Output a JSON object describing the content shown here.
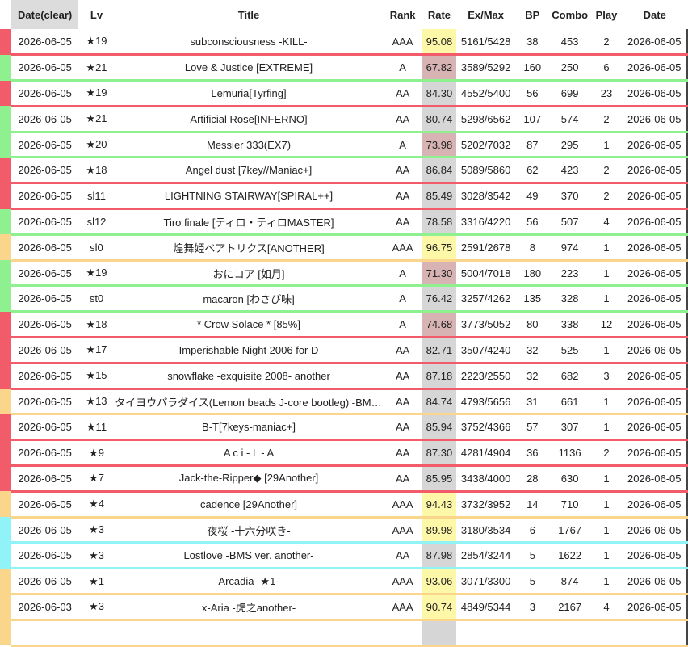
{
  "lamp_colors": {
    "failed": "#f25b6a",
    "easy": "#8ff08f",
    "normal": "#fad68d",
    "hard": "#f25b6a",
    "cyan": "#8ff3f7"
  },
  "rate_colors": {
    "high": "#fdf7a8",
    "mid": "#d6d6d6",
    "low": "#d8b3b3"
  },
  "header": {
    "date_clear": "Date(clear)",
    "lv": "Lv",
    "title": "Title",
    "rank": "Rank",
    "rate": "Rate",
    "exmax": "Ex/Max",
    "bp": "BP",
    "combo": "Combo",
    "play": "Play",
    "date": "Date"
  },
  "rows": [
    {
      "lamp": "#f25b6a",
      "date_clear": "2026-06-05",
      "lv": "★19",
      "title": "subconsciousness -KILL-",
      "rank": "AAA",
      "rate": "95.08",
      "rate_bg": "#fdf7a8",
      "exmax": "5161/5428",
      "bp": "38",
      "combo": "453",
      "play": "2",
      "date": "2026-06-05"
    },
    {
      "lamp": "#8ff08f",
      "date_clear": "2026-06-05",
      "lv": "★21",
      "title": "Love & Justice [EXTREME]",
      "rank": "A",
      "rate": "67.82",
      "rate_bg": "#d8b3b3",
      "exmax": "3589/5292",
      "bp": "160",
      "combo": "250",
      "play": "6",
      "date": "2026-06-05"
    },
    {
      "lamp": "#f25b6a",
      "date_clear": "2026-06-05",
      "lv": "★19",
      "title": "Lemuria[Tyrfing]",
      "rank": "AA",
      "rate": "84.30",
      "rate_bg": "#d6d6d6",
      "exmax": "4552/5400",
      "bp": "56",
      "combo": "699",
      "play": "23",
      "date": "2026-06-05"
    },
    {
      "lamp": "#8ff08f",
      "date_clear": "2026-06-05",
      "lv": "★21",
      "title": "Artificial Rose[INFERNO]",
      "rank": "AA",
      "rate": "80.74",
      "rate_bg": "#d6d6d6",
      "exmax": "5298/6562",
      "bp": "107",
      "combo": "574",
      "play": "2",
      "date": "2026-06-05"
    },
    {
      "lamp": "#8ff08f",
      "date_clear": "2026-06-05",
      "lv": "★20",
      "title": "Messier 333(EX7)",
      "rank": "A",
      "rate": "73.98",
      "rate_bg": "#d8b3b3",
      "exmax": "5202/7032",
      "bp": "87",
      "combo": "295",
      "play": "1",
      "date": "2026-06-05"
    },
    {
      "lamp": "#f25b6a",
      "date_clear": "2026-06-05",
      "lv": "★18",
      "title": "Angel dust [7key//Maniac+]",
      "rank": "AA",
      "rate": "86.84",
      "rate_bg": "#d6d6d6",
      "exmax": "5089/5860",
      "bp": "62",
      "combo": "423",
      "play": "2",
      "date": "2026-06-05"
    },
    {
      "lamp": "#f25b6a",
      "date_clear": "2026-06-05",
      "lv": "sl11",
      "title": "LIGHTNING STAIRWAY[SPIRAL++]",
      "rank": "AA",
      "rate": "85.49",
      "rate_bg": "#d6d6d6",
      "exmax": "3028/3542",
      "bp": "49",
      "combo": "370",
      "play": "2",
      "date": "2026-06-05"
    },
    {
      "lamp": "#8ff08f",
      "date_clear": "2026-06-05",
      "lv": "sl12",
      "title": "Tiro finale [ティロ・ティロMASTER]",
      "rank": "AA",
      "rate": "78.58",
      "rate_bg": "#d6d6d6",
      "exmax": "3316/4220",
      "bp": "56",
      "combo": "507",
      "play": "4",
      "date": "2026-06-05"
    },
    {
      "lamp": "#fad68d",
      "date_clear": "2026-06-05",
      "lv": "sl0",
      "title": "煌舞姫ベアトリクス[ANOTHER]",
      "rank": "AAA",
      "rate": "96.75",
      "rate_bg": "#fdf7a8",
      "exmax": "2591/2678",
      "bp": "8",
      "combo": "974",
      "play": "1",
      "date": "2026-06-05"
    },
    {
      "lamp": "#8ff08f",
      "date_clear": "2026-06-05",
      "lv": "★19",
      "title": "おにコア [如月]",
      "rank": "A",
      "rate": "71.30",
      "rate_bg": "#d8b3b3",
      "exmax": "5004/7018",
      "bp": "180",
      "combo": "223",
      "play": "1",
      "date": "2026-06-05"
    },
    {
      "lamp": "#8ff08f",
      "date_clear": "2026-06-05",
      "lv": "st0",
      "title": "macaron [わさび味]",
      "rank": "A",
      "rate": "76.42",
      "rate_bg": "#d6d6d6",
      "exmax": "3257/4262",
      "bp": "135",
      "combo": "328",
      "play": "1",
      "date": "2026-06-05"
    },
    {
      "lamp": "#f25b6a",
      "date_clear": "2026-06-05",
      "lv": "★18",
      "title": "* Crow Solace * [85%]",
      "rank": "A",
      "rate": "74.68",
      "rate_bg": "#d8b3b3",
      "exmax": "3773/5052",
      "bp": "80",
      "combo": "338",
      "play": "12",
      "date": "2026-06-05"
    },
    {
      "lamp": "#f25b6a",
      "date_clear": "2026-06-05",
      "lv": "★17",
      "title": "Imperishable Night 2006 for D",
      "rank": "AA",
      "rate": "82.71",
      "rate_bg": "#d6d6d6",
      "exmax": "3507/4240",
      "bp": "32",
      "combo": "525",
      "play": "1",
      "date": "2026-06-05"
    },
    {
      "lamp": "#f25b6a",
      "date_clear": "2026-06-05",
      "lv": "★15",
      "title": "snowflake -exquisite 2008- another",
      "rank": "AA",
      "rate": "87.18",
      "rate_bg": "#d6d6d6",
      "exmax": "2223/2550",
      "bp": "32",
      "combo": "682",
      "play": "3",
      "date": "2026-06-05"
    },
    {
      "lamp": "#fad68d",
      "date_clear": "2026-06-05",
      "lv": "★13",
      "title": "タイヨウパラダイス(Lemon beads J-core bootleg) -BMS E...",
      "rank": "AA",
      "rate": "84.74",
      "rate_bg": "#d6d6d6",
      "exmax": "4793/5656",
      "bp": "31",
      "combo": "661",
      "play": "1",
      "date": "2026-06-05"
    },
    {
      "lamp": "#f25b6a",
      "date_clear": "2026-06-05",
      "lv": "★11",
      "title": "B-T[7keys-maniac+]",
      "rank": "AA",
      "rate": "85.94",
      "rate_bg": "#d6d6d6",
      "exmax": "3752/4366",
      "bp": "57",
      "combo": "307",
      "play": "1",
      "date": "2026-06-05"
    },
    {
      "lamp": "#f25b6a",
      "date_clear": "2026-06-05",
      "lv": "★9",
      "title": "A c i - L - A",
      "rank": "AA",
      "rate": "87.30",
      "rate_bg": "#d6d6d6",
      "exmax": "4281/4904",
      "bp": "36",
      "combo": "1136",
      "play": "2",
      "date": "2026-06-05"
    },
    {
      "lamp": "#f25b6a",
      "date_clear": "2026-06-05",
      "lv": "★7",
      "title": "Jack-the-Ripper◆ [29Another]",
      "rank": "AA",
      "rate": "85.95",
      "rate_bg": "#d6d6d6",
      "exmax": "3438/4000",
      "bp": "28",
      "combo": "630",
      "play": "1",
      "date": "2026-06-05"
    },
    {
      "lamp": "#fad68d",
      "date_clear": "2026-06-05",
      "lv": "★4",
      "title": "cadence [29Another]",
      "rank": "AAA",
      "rate": "94.43",
      "rate_bg": "#fdf7a8",
      "exmax": "3732/3952",
      "bp": "14",
      "combo": "710",
      "play": "1",
      "date": "2026-06-05"
    },
    {
      "lamp": "#8ff3f7",
      "date_clear": "2026-06-05",
      "lv": "★3",
      "title": "夜桜 -十六分咲き-",
      "rank": "AAA",
      "rate": "89.98",
      "rate_bg": "#fdf7a8",
      "exmax": "3180/3534",
      "bp": "6",
      "combo": "1767",
      "play": "1",
      "date": "2026-06-05"
    },
    {
      "lamp": "#8ff3f7",
      "date_clear": "2026-06-05",
      "lv": "★3",
      "title": "Lostlove -BMS ver. another-",
      "rank": "AA",
      "rate": "87.98",
      "rate_bg": "#d6d6d6",
      "exmax": "2854/3244",
      "bp": "5",
      "combo": "1622",
      "play": "1",
      "date": "2026-06-05"
    },
    {
      "lamp": "#fad68d",
      "date_clear": "2026-06-05",
      "lv": "★1",
      "title": "Arcadia -★1-",
      "rank": "AAA",
      "rate": "93.06",
      "rate_bg": "#fdf7a8",
      "exmax": "3071/3300",
      "bp": "5",
      "combo": "874",
      "play": "1",
      "date": "2026-06-05"
    },
    {
      "lamp": "#fad68d",
      "date_clear": "2026-06-03",
      "lv": "★3",
      "title": "x-Aria -虎之another-",
      "rank": "AAA",
      "rate": "90.74",
      "rate_bg": "#fdf7a8",
      "exmax": "4849/5344",
      "bp": "3",
      "combo": "2167",
      "play": "4",
      "date": "2026-06-05"
    },
    {
      "lamp": "#fad68d",
      "date_clear": "",
      "lv": "",
      "title": "",
      "rank": "",
      "rate": "",
      "rate_bg": "#d6d6d6",
      "exmax": "",
      "bp": "",
      "combo": "",
      "play": "",
      "date": ""
    }
  ]
}
